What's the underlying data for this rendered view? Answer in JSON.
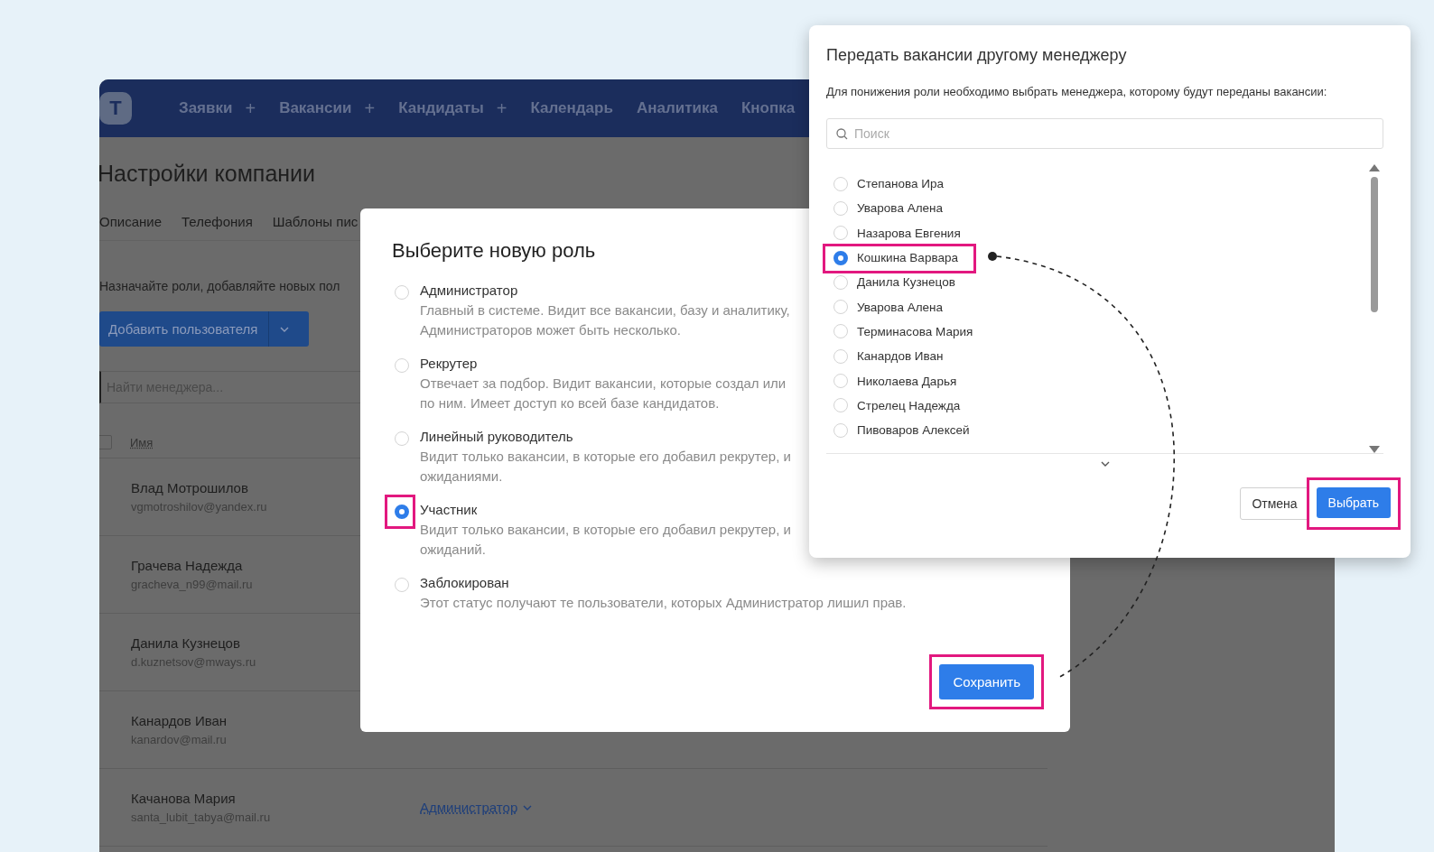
{
  "app": {
    "nav": [
      {
        "label": "Заявки",
        "plus": "+"
      },
      {
        "label": "Вакансии",
        "plus": "+"
      },
      {
        "label": "Кандидаты",
        "plus": "+"
      },
      {
        "label": "Календарь"
      },
      {
        "label": "Аналитика"
      },
      {
        "label": "Кнопка"
      }
    ],
    "logo": "T",
    "page_title": "Настройки компании",
    "tabs": [
      "Описание",
      "Телефония",
      "Шаблоны пис"
    ],
    "intro": "Назначайте роли, добавляйте новых пол",
    "add_button": "Добавить пользователя",
    "search": {
      "placeholder": "Найти менеджера..."
    },
    "table": {
      "select_all": {
        "checked": false
      },
      "columns": [
        "Имя"
      ],
      "rows": [
        {
          "name": "Влад Мотрошилов",
          "email": "vgmotroshilov@yandex.ru"
        },
        {
          "name": "Грачева Надежда",
          "email": "gracheva_n99@mail.ru"
        },
        {
          "name": "Данила Кузнецов",
          "email": "d.kuznetsov@mways.ru"
        },
        {
          "name": "Канардов Иван",
          "email": "kanardov@mail.ru"
        },
        {
          "name": "Качанова Мария",
          "email": "santa_lubit_tabya@mail.ru",
          "role": "Администратор"
        }
      ]
    }
  },
  "role_dialog": {
    "title": "Выберите новую роль",
    "options": [
      {
        "label": "Администратор",
        "description": [
          "Главный в системе. Видит все вакансии, базу и аналитику,",
          "Администраторов может быть несколько."
        ],
        "selected": false
      },
      {
        "label": "Рекрутер",
        "description": [
          "Отвечает за подбор. Видит вакансии, которые создал или",
          "по ним. Имеет доступ ко всей базе кандидатов."
        ],
        "selected": false
      },
      {
        "label": "Линейный руководитель",
        "description": [
          "Видит только вакансии, в которые его добавил рекрутер, и",
          "ожиданиями."
        ],
        "selected": false
      },
      {
        "label": "Участник",
        "description": [
          "Видит только вакансии, в которые его добавил рекрутер, и",
          "ожиданий."
        ],
        "selected": true
      },
      {
        "label": "Заблокирован",
        "description": [
          "Этот статус получают те пользователи, которых Администратор лишил прав."
        ],
        "selected": false
      }
    ],
    "save_button": {
      "label": "Сохранить",
      "highlighted": true
    }
  },
  "transfer_dialog": {
    "title": "Передать вакансии другому менеджеру",
    "description": "Для понижения роли необходимо выбрать менеджера, которому будут переданы вакансии:",
    "search": {
      "placeholder": "Поиск"
    },
    "managers": [
      {
        "name": "Степанова Ира",
        "selected": false
      },
      {
        "name": "Уварова Алена",
        "selected": false
      },
      {
        "name": "Назарова Евгения",
        "selected": false
      },
      {
        "name": "Кошкина Варвара",
        "selected": true
      },
      {
        "name": "Данила Кузнецов",
        "selected": false
      },
      {
        "name": "Уварова Алена",
        "selected": false
      },
      {
        "name": "Терминасова Мария",
        "selected": false
      },
      {
        "name": "Канардов Иван",
        "selected": false
      },
      {
        "name": "Николаева Дарья",
        "selected": false
      },
      {
        "name": "Стрелец Надежда",
        "selected": false
      },
      {
        "name": "Пивоваров Алексей",
        "selected": false
      }
    ],
    "cancel_button": {
      "label": "Отмена"
    },
    "choose_button": {
      "label": "Выбрать",
      "highlighted": true
    }
  }
}
